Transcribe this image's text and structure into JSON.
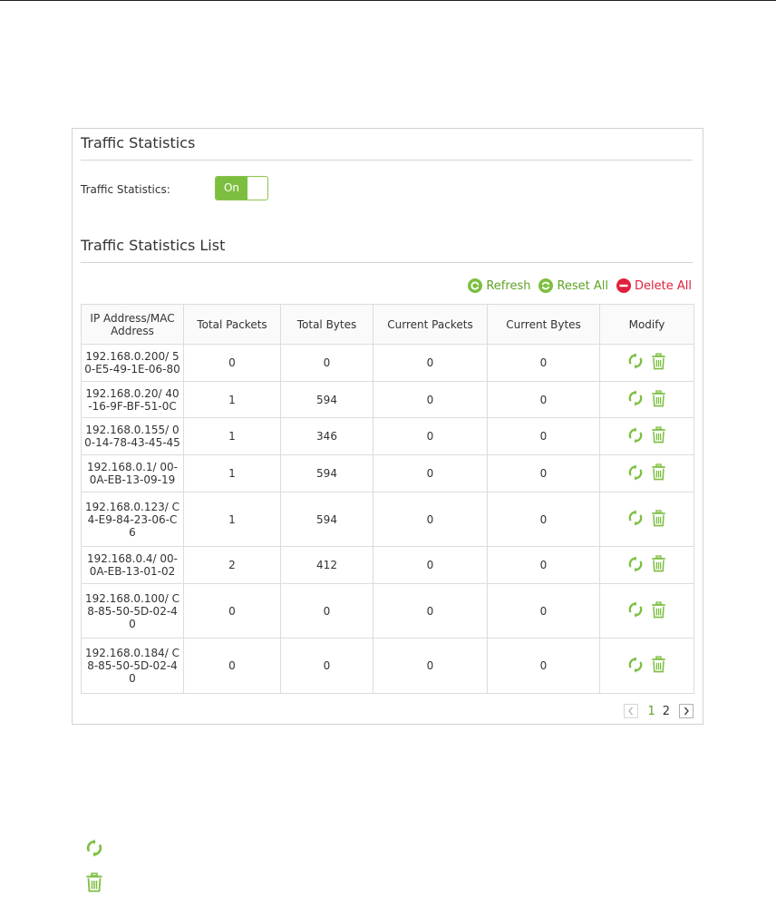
{
  "panel": {
    "title": "Traffic Statistics",
    "toggle_label": "Traffic Statistics:",
    "toggle_state": "On",
    "list_title": "Traffic Statistics List"
  },
  "actions": {
    "refresh": "Refresh",
    "reset_all": "Reset All",
    "delete_all": "Delete All"
  },
  "table": {
    "columns": [
      "IP Address/MAC Address",
      "Total Packets",
      "Total Bytes",
      "Current Packets",
      "Current Bytes",
      "Modify"
    ],
    "rows": [
      {
        "ip": "192.168.0.200/ 50-E5-49-1E-06-80",
        "total_packets": "0",
        "total_bytes": "0",
        "current_packets": "0",
        "current_bytes": "0"
      },
      {
        "ip": "192.168.0.20/ 40-16-9F-BF-51-0C",
        "total_packets": "1",
        "total_bytes": "594",
        "current_packets": "0",
        "current_bytes": "0"
      },
      {
        "ip": "192.168.0.155/ 00-14-78-43-45-45",
        "total_packets": "1",
        "total_bytes": "346",
        "current_packets": "0",
        "current_bytes": "0"
      },
      {
        "ip": "192.168.0.1/ 00-0A-EB-13-09-19",
        "total_packets": "1",
        "total_bytes": "594",
        "current_packets": "0",
        "current_bytes": "0"
      },
      {
        "ip": "192.168.0.123/ C4-E9-84-23-06-C6",
        "total_packets": "1",
        "total_bytes": "594",
        "current_packets": "0",
        "current_bytes": "0"
      },
      {
        "ip": "192.168.0.4/ 00-0A-EB-13-01-02",
        "total_packets": "2",
        "total_bytes": "412",
        "current_packets": "0",
        "current_bytes": "0"
      },
      {
        "ip": "192.168.0.100/ C8-85-50-5D-02-40",
        "total_packets": "0",
        "total_bytes": "0",
        "current_packets": "0",
        "current_bytes": "0"
      },
      {
        "ip": "192.168.0.184/ C8-85-50-5D-02-40",
        "total_packets": "0",
        "total_bytes": "0",
        "current_packets": "0",
        "current_bytes": "0"
      }
    ]
  },
  "pagination": {
    "pages": [
      "1",
      "2"
    ],
    "current": "1"
  },
  "icons": {
    "refresh": "refresh-icon",
    "reset": "reset-icon",
    "delete_all": "delete-circle-icon",
    "row_refresh": "refresh-arrows-icon",
    "row_delete": "trash-icon",
    "prev": "chevron-left-icon",
    "next": "chevron-right-icon"
  },
  "colors": {
    "accent_green": "#7cbf40",
    "link_green": "#5da225",
    "delete_red": "#e0203c",
    "border": "#dcdcdc"
  }
}
